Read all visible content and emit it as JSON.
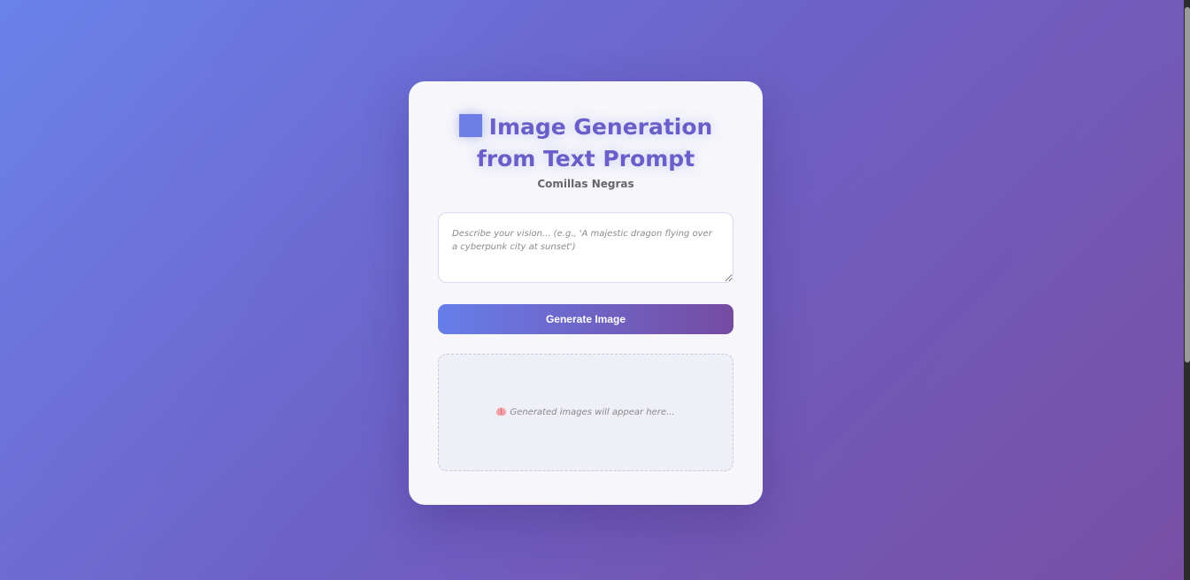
{
  "header": {
    "title_icon": "blue-square-icon",
    "title": "Image Generation from Text Prompt",
    "subtitle": "Comillas Negras"
  },
  "prompt": {
    "value": "",
    "placeholder": "Describe your vision... (e.g., 'A majestic dragon flying over a cyberpunk city at sunset')"
  },
  "generate": {
    "label": "Generate Image"
  },
  "output": {
    "icon": "brain-icon",
    "placeholder": "Generated images will appear here..."
  },
  "theme": {
    "gradient_start": "#667eea",
    "gradient_end": "#764ba2",
    "card_background": "#f7f6fb",
    "title_color": "#6a5ec8"
  }
}
